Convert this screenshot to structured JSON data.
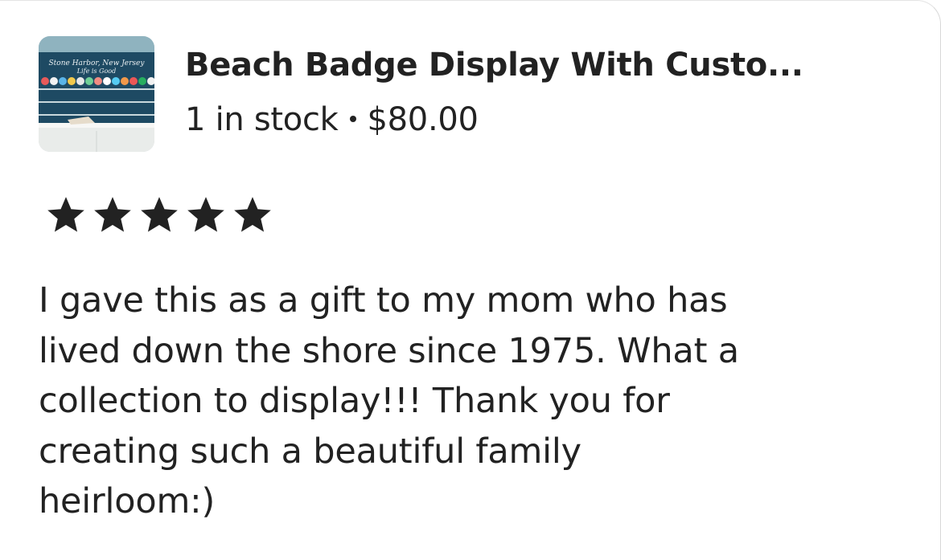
{
  "listing": {
    "title": "Beach Badge Display With Custo...",
    "stock": "1 in stock",
    "separator": "•",
    "price": "$80.00",
    "thumbnail": {
      "sign_line1": "Stone Harbor, New Jersey",
      "sign_line2": "Life is Good"
    }
  },
  "review": {
    "rating": 5,
    "rating_max": 5,
    "star_color": "#222222",
    "text": "I gave this as a gift to my mom who has\nlived down the shore since 1975.  What a\ncollection to display!!!  Thank you for\ncreating such a beautiful family\nheirloom:)"
  },
  "colors": {
    "text": "#222222",
    "background": "#ffffff",
    "thumbnail_navy": "#1e4a63"
  }
}
